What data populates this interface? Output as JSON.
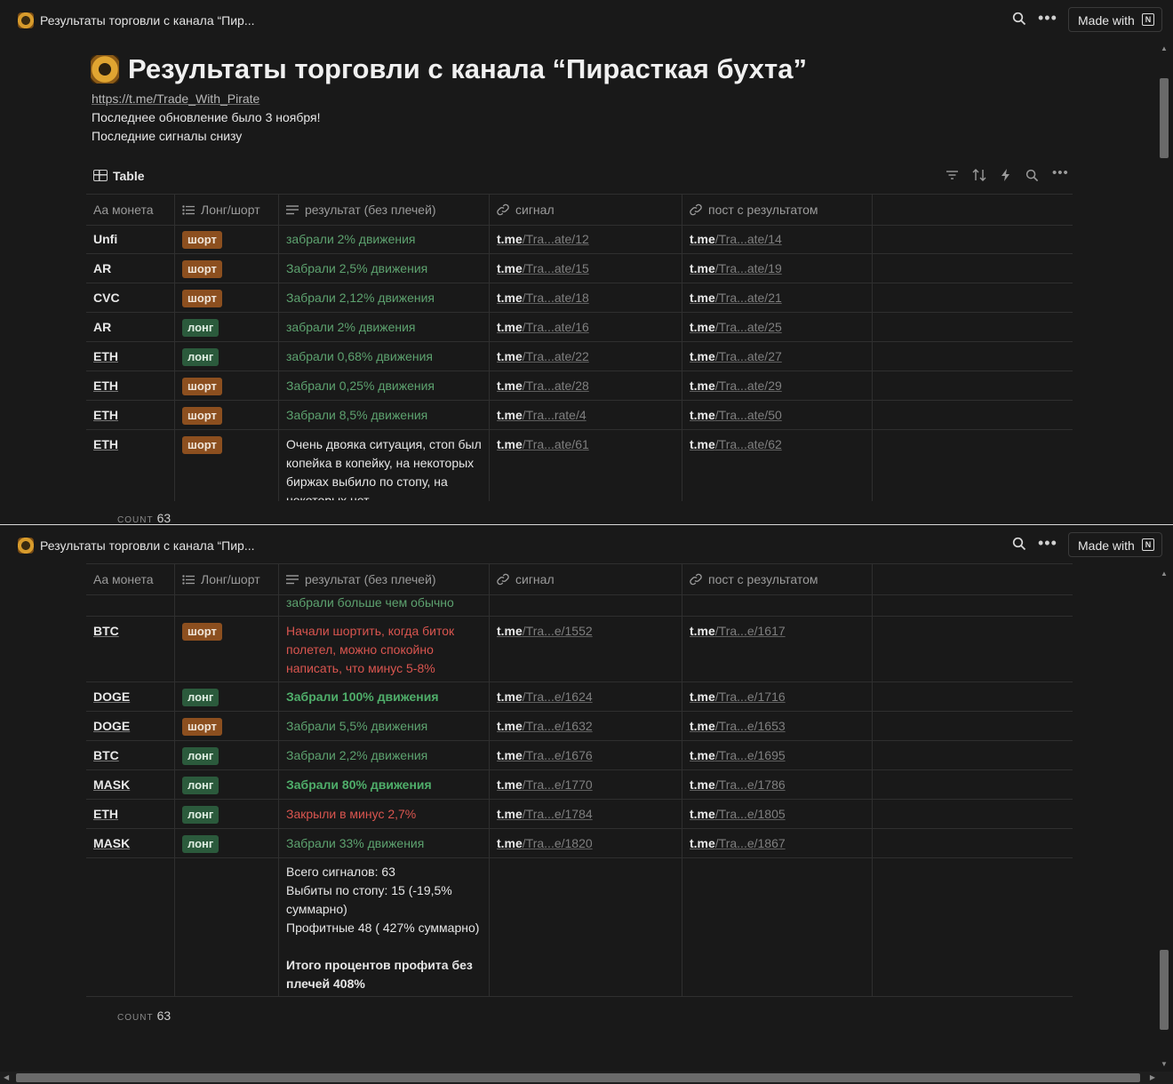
{
  "window": {
    "tab_title": "Результаты торговли с канала “Пир...",
    "made_with": "Made with",
    "notion_mark": "N"
  },
  "page": {
    "title": "Результаты торговли с канала “Пирасткая бухта”",
    "link": "https://t.me/Trade_With_Pirate",
    "line1": "Последнее обновление было 3 ноября!",
    "line2": "Последние сигналы снизу"
  },
  "table": {
    "view_label": "Table",
    "columns": [
      "Aa монета",
      "Лонг/шорт",
      "результат (без плечей)",
      "сигнал",
      "пост с результатом"
    ],
    "count_label": "COUNT",
    "count_value": "63",
    "rows_top": [
      {
        "coin": "Unfi",
        "side": "шорт",
        "side_type": "short",
        "result": "забрали 2% движения",
        "signal": [
          "t.me",
          "/Tra...ate/12"
        ],
        "post": [
          "t.me",
          "/Tra...ate/14"
        ]
      },
      {
        "coin": "AR",
        "side": "шорт",
        "side_type": "short",
        "result": "Забрали 2,5% движения",
        "signal": [
          "t.me",
          "/Tra...ate/15"
        ],
        "post": [
          "t.me",
          "/Tra...ate/19"
        ]
      },
      {
        "coin": "CVC",
        "side": "шорт",
        "side_type": "short",
        "result": "Забрали 2,12% движения",
        "signal": [
          "t.me",
          "/Tra...ate/18"
        ],
        "post": [
          "t.me",
          "/Tra...ate/21"
        ]
      },
      {
        "coin": "AR",
        "side": "лонг",
        "side_type": "long",
        "result": "забрали 2% движения",
        "signal": [
          "t.me",
          "/Tra...ate/16"
        ],
        "post": [
          "t.me",
          "/Tra...ate/25"
        ]
      },
      {
        "coin": "ETH",
        "side": "лонг",
        "side_type": "long",
        "result": "забрали 0,68% движения",
        "signal": [
          "t.me",
          "/Tra...ate/22"
        ],
        "post": [
          "t.me",
          "/Tra...ate/27"
        ]
      },
      {
        "coin": "ETH",
        "side": "шорт",
        "side_type": "short",
        "result": "Забрали 0,25% движения",
        "signal": [
          "t.me",
          "/Tra...ate/28"
        ],
        "post": [
          "t.me",
          "/Tra...ate/29"
        ]
      },
      {
        "coin": "ETH",
        "side": "шорт",
        "side_type": "short",
        "result": "Забрали 8,5% движения",
        "signal": [
          "t.me",
          "/Tra...rate/4"
        ],
        "post": [
          "t.me",
          "/Tra...ate/50"
        ]
      },
      {
        "coin": "ETH",
        "side": "шорт",
        "side_type": "short",
        "result": "Очень двояка ситуация, стоп был копейка в копейку, на некоторых биржах выбило по стопу, на некоторых нет",
        "signal": [
          "t.me",
          "/Tra...ate/61"
        ],
        "post": [
          "t.me",
          "/Tra...ate/62"
        ]
      }
    ],
    "partial_row_text": "забрали больше чем обычно",
    "rows_bottom": [
      {
        "coin": "BTC",
        "side": "шорт",
        "side_type": "short",
        "result": "Начали шортить, когда биток полетел, можно спокойно написать, что минус 5-8%",
        "signal": [
          "t.me",
          "/Tra...e/1552"
        ],
        "post": [
          "t.me",
          "/Tra...e/1617"
        ]
      },
      {
        "coin": "DOGE",
        "side": "лонг",
        "side_type": "long",
        "result": "Забрали 100% движения",
        "signal": [
          "t.me",
          "/Tra...e/1624"
        ],
        "post": [
          "t.me",
          "/Tra...e/1716"
        ]
      },
      {
        "coin": "DOGE",
        "side": "шорт",
        "side_type": "short",
        "result": "Забрали 5,5% движения",
        "signal": [
          "t.me",
          "/Tra...e/1632"
        ],
        "post": [
          "t.me",
          "/Tra...e/1653"
        ]
      },
      {
        "coin": "BTC",
        "side": "лонг",
        "side_type": "long",
        "result": "Забрали 2,2% движения",
        "signal": [
          "t.me",
          "/Tra...e/1676"
        ],
        "post": [
          "t.me",
          "/Tra...e/1695"
        ]
      },
      {
        "coin": "MASK",
        "side": "лонг",
        "side_type": "long",
        "result": "Забрали 80% движения",
        "signal": [
          "t.me",
          "/Tra...e/1770"
        ],
        "post": [
          "t.me",
          "/Tra...e/1786"
        ]
      },
      {
        "coin": "ETH",
        "side": "лонг",
        "side_type": "long",
        "result": "Закрыли в минус 2,7%",
        "signal": [
          "t.me",
          "/Tra...e/1784"
        ],
        "post": [
          "t.me",
          "/Tra...e/1805"
        ]
      },
      {
        "coin": "MASK",
        "side": "лонг",
        "side_type": "long",
        "result": "Забрали 33% движения",
        "signal": [
          "t.me",
          "/Tra...e/1820"
        ],
        "post": [
          "t.me",
          "/Tra...e/1867"
        ]
      }
    ],
    "summary": {
      "line1": "Всего сигналов: 63",
      "line2": "Выбиты по стопу: 15 (-19,5% суммарно)",
      "line3": "Профитные 48 ( 427% суммарно)",
      "line4": "Итого процентов профита без плечей 408%"
    }
  },
  "colors": {
    "short_tag": "#8c4f1f",
    "long_tag": "#2b5a3c",
    "green_text": "#5da26f",
    "red_text": "#d9554f"
  }
}
